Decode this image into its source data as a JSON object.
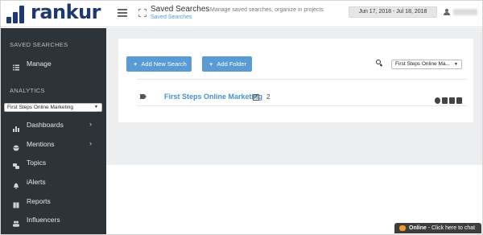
{
  "header": {
    "logo_text": "rankur",
    "title": "Saved Searches",
    "subtitle": "Saved Searches",
    "description": "Manage saved searches, organize in projects",
    "date_range": "Jun 17, 2018 - Jul 18, 2018"
  },
  "sidebar": {
    "section_saved": "SAVED SEARCHES",
    "manage": "Manage",
    "section_analytics": "ANALYTICS",
    "selected_search": "First Steps Online Marketing",
    "items": [
      {
        "label": "Dashboards",
        "icon": "bar-chart-icon"
      },
      {
        "label": "Mentions",
        "icon": "globe-icon"
      },
      {
        "label": "Topics",
        "icon": "comments-icon"
      },
      {
        "label": "iAlerts",
        "icon": "bell-icon"
      },
      {
        "label": "Reports",
        "icon": "book-icon"
      },
      {
        "label": "Influencers",
        "icon": "users-icon"
      }
    ]
  },
  "main": {
    "add_search_label": "Add New Search",
    "add_folder_label": "Add Folder",
    "filter_selected": "First Steps Online Ma...",
    "rows": [
      {
        "name": "First Steps Online Marketing",
        "count": "2"
      }
    ]
  },
  "chat": {
    "status": "Online",
    "message": " - Click here to chat"
  },
  "colors": {
    "sidebar_bg": "#2c3339",
    "accent": "#5b9bd5",
    "link": "#4a8fd0",
    "brand": "#1c3a6e",
    "chat_bubble": "#f19a2b"
  }
}
